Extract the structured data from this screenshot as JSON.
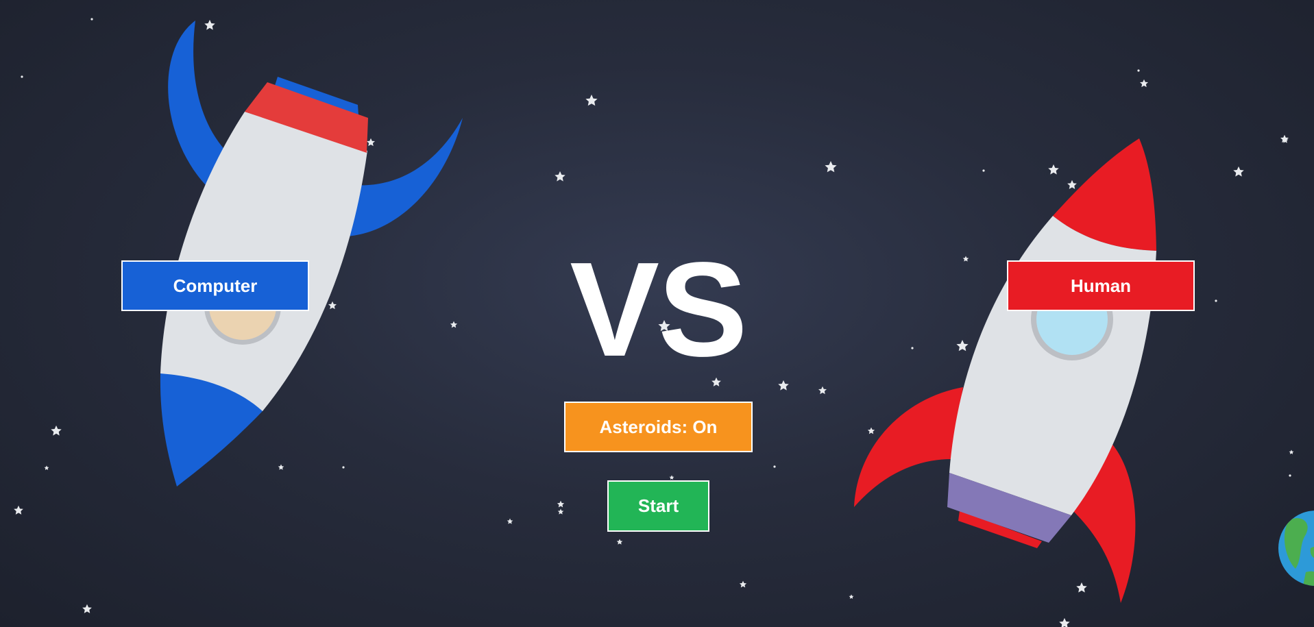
{
  "title": "VS",
  "players": {
    "left_label": "Computer",
    "right_label": "Human"
  },
  "buttons": {
    "asteroids_label": "Asteroids: On",
    "start_label": "Start"
  },
  "colors": {
    "background": "#272c3c",
    "computer_blue": "#1761d6",
    "human_red": "#e81c24",
    "asteroids_orange": "#f7931e",
    "start_green": "#22b556",
    "rocket_body": "#dfe2e6",
    "earth_ocean": "#2d9ad8",
    "earth_land": "#4cae4f"
  },
  "icons": {
    "left_rocket": "blue-rocket-icon",
    "right_rocket": "red-rocket-icon",
    "planet": "earth-icon",
    "background_stars": "star-icon"
  },
  "asteroids_enabled": true
}
